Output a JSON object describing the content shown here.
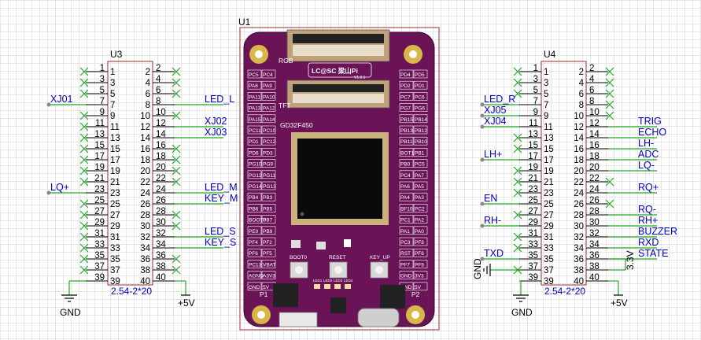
{
  "designators": {
    "u1": "U1",
    "u3": "U3",
    "u4": "U4"
  },
  "packages": {
    "u3": "2.54-2*20",
    "u4": "2.54-2*20"
  },
  "power": {
    "gnd": "GND",
    "v5": "+5V",
    "v33": "3.3V"
  },
  "u3": {
    "left": {
      "7": "XJ01",
      "23": "LQ+"
    },
    "right": {
      "8": "LED_L",
      "12": "XJ02",
      "14": "XJ03",
      "24": "LED_M",
      "26": "KEY_M",
      "32": "LED_S",
      "34": "KEY_S"
    }
  },
  "u4": {
    "left": {
      "7": "LED_R",
      "9": "XJ05",
      "11": "XJ04",
      "17": "LH+",
      "25": "EN",
      "29": "RH-",
      "35": "TXD"
    },
    "right": {
      "12": "TRIG",
      "14": "ECHO",
      "16": "LH-",
      "18": "ADC",
      "20": "LQ-",
      "24": "RQ+",
      "28": "RQ-",
      "30": "RH+",
      "32": "BUZZER",
      "34": "RXD",
      "36": "STATE"
    }
  },
  "board": {
    "chip": "GD32F450",
    "logo": "LC@SC 梁山Pi",
    "version": "V1.0.1",
    "rgb": "RGB",
    "tft": "TFT",
    "buttons": [
      "BOOT0",
      "RESET",
      "KEY_UP"
    ],
    "p1": "P1",
    "p2": "P2",
    "leds": [
      "LED1",
      "LED2",
      "LED3",
      "LED4"
    ],
    "left_pins": [
      [
        "PC5",
        "PC4"
      ],
      [
        "PA8",
        "PA9"
      ],
      [
        "PA11",
        "PA10"
      ],
      [
        "PA13",
        "PA12"
      ],
      [
        "PA15",
        "PA14"
      ],
      [
        "PC11",
        "PC10"
      ],
      [
        "PD1",
        "PC12"
      ],
      [
        "PD6",
        "PD3"
      ],
      [
        "PG10",
        "PG9"
      ],
      [
        "PG12",
        "PG11"
      ],
      [
        "PG14",
        "PG13"
      ],
      [
        "PB4",
        "PB3"
      ],
      [
        "PB6",
        "PB5"
      ],
      [
        "BOOT0",
        "PB7"
      ],
      [
        "PE0",
        "PB9"
      ],
      [
        "PF4",
        "PF2"
      ],
      [
        "PF6",
        "PF5"
      ],
      [
        "PC13",
        "VBAT"
      ],
      [
        "AGND",
        "A3V3"
      ],
      [
        "GND",
        "5V"
      ]
    ],
    "right_pins": [
      [
        "PD4",
        "PD5"
      ],
      [
        "PD2",
        "PD1"
      ],
      [
        "PC7",
        "PC6"
      ],
      [
        "PG7",
        "PG6"
      ],
      [
        "PB15",
        "PB14"
      ],
      [
        "PB13",
        "PB12"
      ],
      [
        "PB11",
        "PB10"
      ],
      [
        "BOT1",
        "PB1"
      ],
      [
        "PB0",
        "PC5"
      ],
      [
        "PC4",
        "PA7"
      ],
      [
        "PA6",
        "PA5"
      ],
      [
        "PA4",
        "PA3"
      ],
      [
        "BF10",
        "PC2"
      ],
      [
        "PC1",
        "PA2"
      ],
      [
        "PA1",
        "PA0"
      ],
      [
        "PC3",
        "PF8"
      ],
      [
        "RST",
        "PF6"
      ],
      [
        "PF7",
        "PF9"
      ],
      [
        "GND",
        "3V3"
      ],
      [
        "GND",
        "5V"
      ]
    ]
  }
}
